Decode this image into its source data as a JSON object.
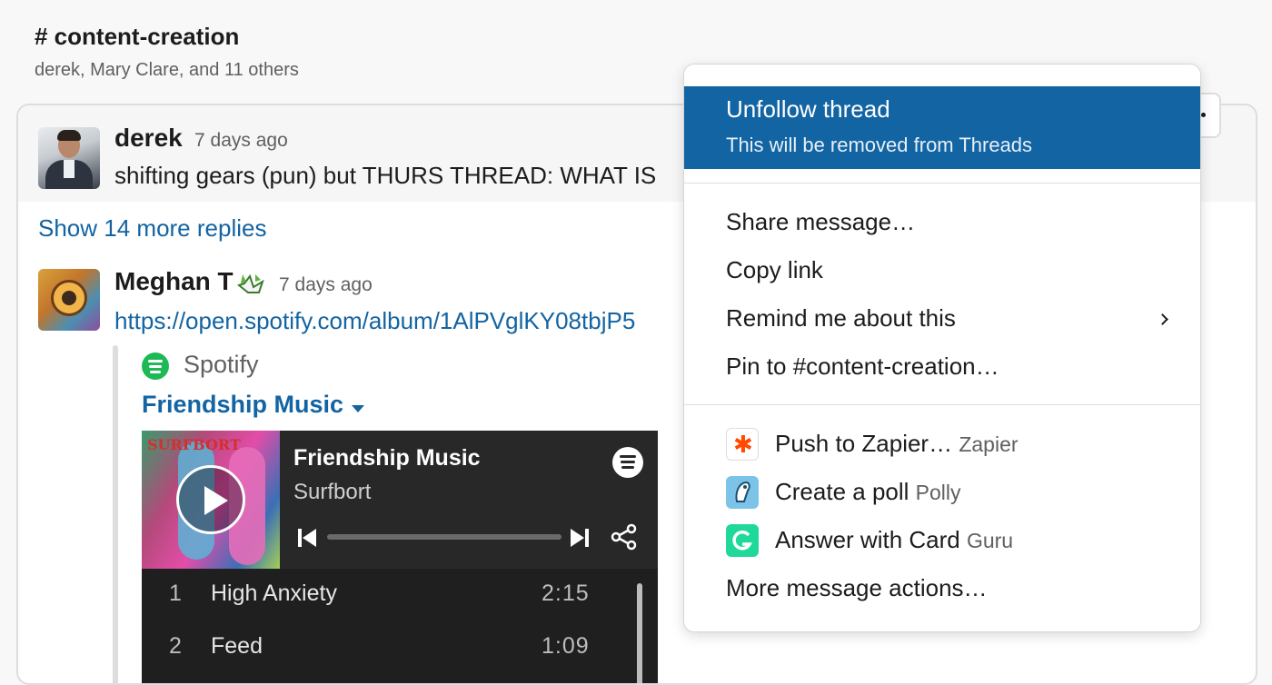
{
  "channel": {
    "title": "# content-creation",
    "members": "derek, Mary Clare, and 11 others"
  },
  "parent_message": {
    "author": "derek",
    "time": "7 days ago",
    "text": "shifting gears (pun) but THURS THREAD: WHAT IS"
  },
  "thread": {
    "more_replies": "Show 14 more replies"
  },
  "reply": {
    "author": "Meghan T",
    "time": "7 days ago",
    "link": "https://open.spotify.com/album/1AlPVglKY08tbjP5"
  },
  "attachment": {
    "service": "Spotify",
    "title": "Friendship Music",
    "player": {
      "album_art_text": "SURFBORT",
      "track_title": "Friendship Music",
      "artist": "Surfbort",
      "tracks": [
        {
          "num": "1",
          "name": "High Anxiety",
          "duration": "2:15"
        },
        {
          "num": "2",
          "name": "Feed",
          "duration": "1:09"
        }
      ]
    }
  },
  "context_menu": {
    "unfollow": {
      "label": "Unfollow thread",
      "sub": "This will be removed from Threads"
    },
    "share": "Share message…",
    "copy_link": "Copy link",
    "remind": "Remind me about this",
    "pin": "Pin to #content-creation…",
    "apps": [
      {
        "label": "Push to Zapier…",
        "app": "Zapier",
        "icon": "zapier-icon"
      },
      {
        "label": "Create a poll",
        "app": "Polly",
        "icon": "polly-icon"
      },
      {
        "label": "Answer with Card",
        "app": "Guru",
        "icon": "guru-icon"
      }
    ],
    "more": "More message actions…"
  },
  "colors": {
    "highlight": "#1264a3",
    "link": "#1264a3",
    "spotify_green": "#1db954"
  }
}
